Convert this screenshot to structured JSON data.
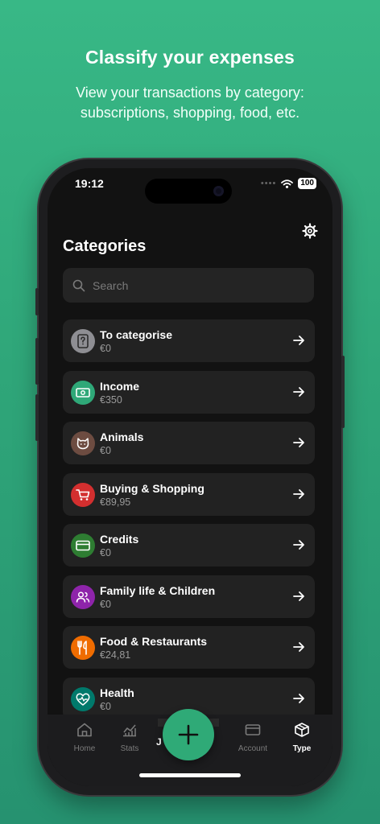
{
  "promo": {
    "headline": "Classify your expenses",
    "subline_1": "View your transactions by category:",
    "subline_2": "subscriptions, shopping, food, etc."
  },
  "status_bar": {
    "time": "19:12",
    "battery": "100"
  },
  "page": {
    "title": "Categories"
  },
  "search": {
    "placeholder": "Search"
  },
  "categories": [
    {
      "name": "To categorise",
      "amount": "€0",
      "icon": "question-doc-icon",
      "color": "#8e8e93"
    },
    {
      "name": "Income",
      "amount": "€350",
      "icon": "banknote-icon",
      "color": "#2fa878"
    },
    {
      "name": "Animals",
      "amount": "€0",
      "icon": "cat-icon",
      "color": "#6d4c41"
    },
    {
      "name": "Buying & Shopping",
      "amount": "€89,95",
      "icon": "cart-icon",
      "color": "#d32f2f"
    },
    {
      "name": "Credits",
      "amount": "€0",
      "icon": "credit-card-icon",
      "color": "#2e7d32"
    },
    {
      "name": "Family life & Children",
      "amount": "€0",
      "icon": "people-icon",
      "color": "#8e24aa"
    },
    {
      "name": "Food & Restaurants",
      "amount": "€24,81",
      "icon": "fork-knife-icon",
      "color": "#ef6c00"
    },
    {
      "name": "Health",
      "amount": "€0",
      "icon": "heart-pulse-icon",
      "color": "#00796b"
    }
  ],
  "tabs": [
    {
      "label": "Home",
      "icon": "home-icon"
    },
    {
      "label": "Stats",
      "icon": "chart-icon"
    },
    {
      "label": "Account",
      "icon": "card-icon"
    },
    {
      "label": "Type",
      "icon": "cube-icon",
      "active": true
    }
  ],
  "peek_label": "J"
}
